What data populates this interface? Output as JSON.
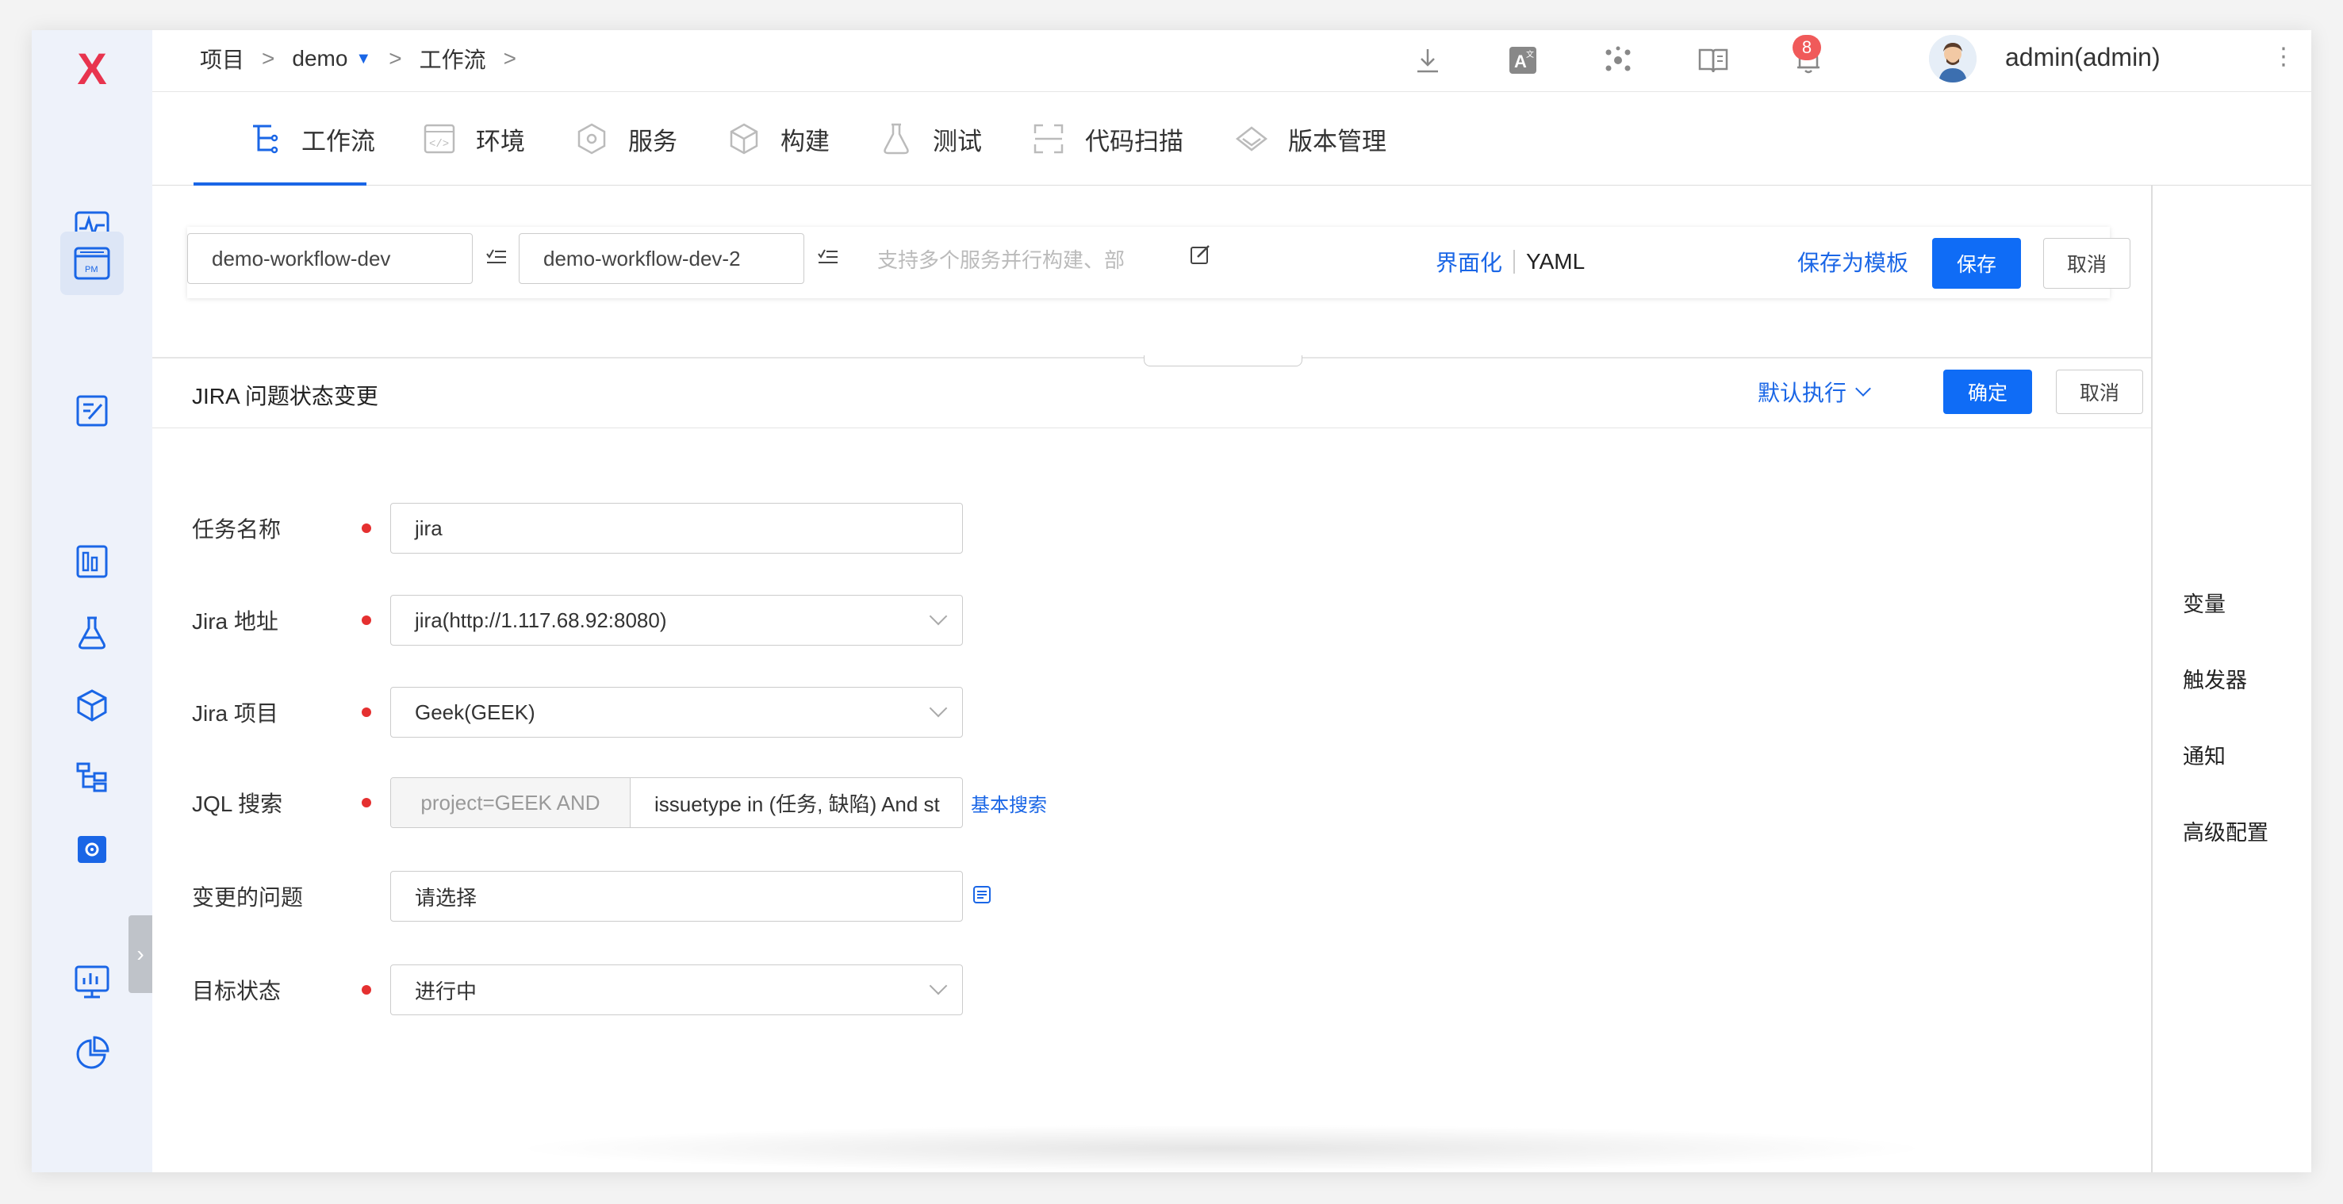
{
  "app": {
    "logo": "X",
    "accent": "#1a66e6",
    "brand": "#e8344e"
  },
  "breadcrumb": {
    "project": "项目",
    "sep1": ">",
    "demo": "demo",
    "sep2": ">",
    "workflow": "工作流",
    "sep3": ">"
  },
  "topbar": {
    "icons": [
      "download-icon",
      "translate-icon",
      "cluster-icon",
      "book-icon",
      "bell-icon"
    ],
    "notification_count": "8",
    "user": "admin(admin)",
    "more": "⋮"
  },
  "sidebar": {
    "items": [
      "monitor-wave-icon",
      "pm-icon",
      "edit-doc-icon",
      "dashboard-icon",
      "flask-icon",
      "package-icon",
      "tree-icon",
      "settings-icon",
      "chart-screen-icon",
      "pie-chart-icon"
    ],
    "active": "pm-icon",
    "collapse": "›"
  },
  "tabs": [
    {
      "label": "工作流",
      "icon": "workflow-icon",
      "active": true
    },
    {
      "label": "环境",
      "icon": "code-env-icon"
    },
    {
      "label": "服务",
      "icon": "service-icon"
    },
    {
      "label": "构建",
      "icon": "build-icon"
    },
    {
      "label": "测试",
      "icon": "test-icon"
    },
    {
      "label": "代码扫描",
      "icon": "scan-icon"
    },
    {
      "label": "版本管理",
      "icon": "version-icon"
    }
  ],
  "right_panel": {
    "items": [
      "变量",
      "触发器",
      "通知",
      "高级配置"
    ]
  },
  "workflow_bar": {
    "name1": "demo-workflow-dev",
    "name2": "demo-workflow-dev-2",
    "desc_placeholder": "支持多个服务并行构建、部",
    "mode_ui": "界面化",
    "mode_yaml": "YAML",
    "save_template": "保存为模板",
    "save": "保存",
    "cancel": "取消"
  },
  "sheet": {
    "title": "JIRA 问题状态变更",
    "exec_mode": "默认执行",
    "confirm": "确定",
    "cancel": "取消",
    "fields": {
      "task_name": {
        "label": "任务名称",
        "value": "jira"
      },
      "jira_address": {
        "label": "Jira 地址",
        "value": "jira(http://1.117.68.92:8080)"
      },
      "jira_project": {
        "label": "Jira 项目",
        "value": "Geek(GEEK)"
      },
      "jql": {
        "label": "JQL 搜索",
        "prefix": "project=GEEK AND",
        "value": "issuetype in (任务, 缺陷) And st",
        "link": "基本搜索"
      },
      "issues": {
        "label": "变更的问题",
        "placeholder": "请选择"
      },
      "target_status": {
        "label": "目标状态",
        "value": "进行中"
      }
    }
  }
}
